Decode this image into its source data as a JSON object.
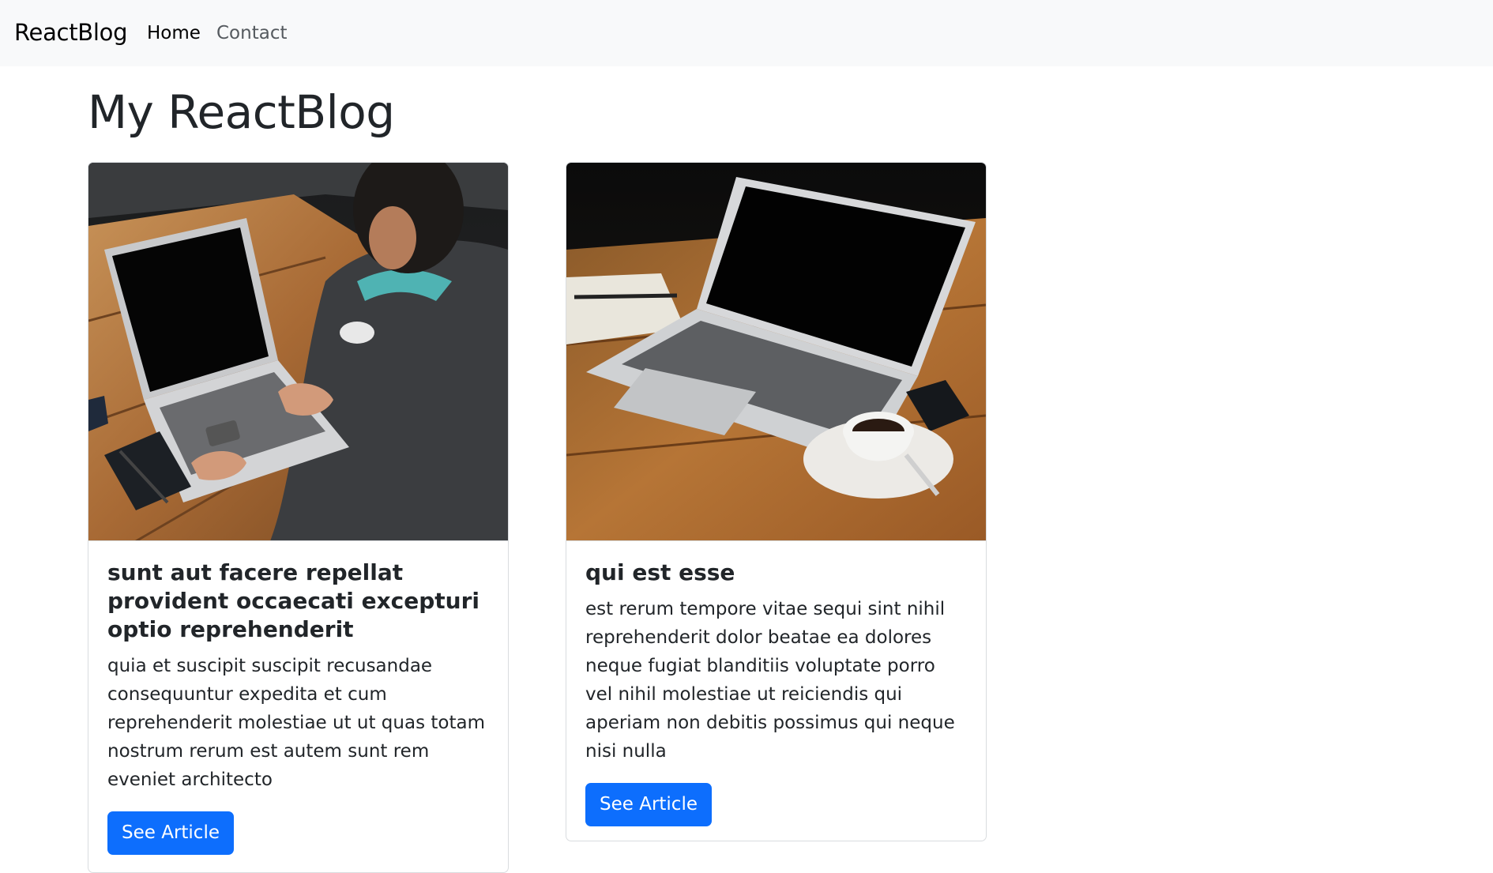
{
  "navbar": {
    "brand": "ReactBlog",
    "links": [
      {
        "label": "Home"
      },
      {
        "label": "Contact"
      }
    ]
  },
  "page": {
    "title": "My ReactBlog"
  },
  "posts": [
    {
      "title": "sunt aut facere repellat provident occaecati excepturi optio reprehenderit",
      "body": "quia et suscipit suscipit recusandae consequuntur expedita et cum reprehenderit molestiae ut ut quas totam nostrum rerum est autem sunt rem eveniet architecto",
      "button_label": "See Article"
    },
    {
      "title": "qui est esse",
      "body": "est rerum tempore vitae sequi sint nihil reprehenderit dolor beatae ea dolores neque fugiat blanditiis voluptate porro vel nihil molestiae ut reiciendis qui aperiam non debitis possimus qui neque nisi nulla",
      "button_label": "See Article"
    }
  ],
  "colors": {
    "navbar_bg": "#f8f9fa",
    "primary": "#0d6efd",
    "text": "#212529"
  }
}
